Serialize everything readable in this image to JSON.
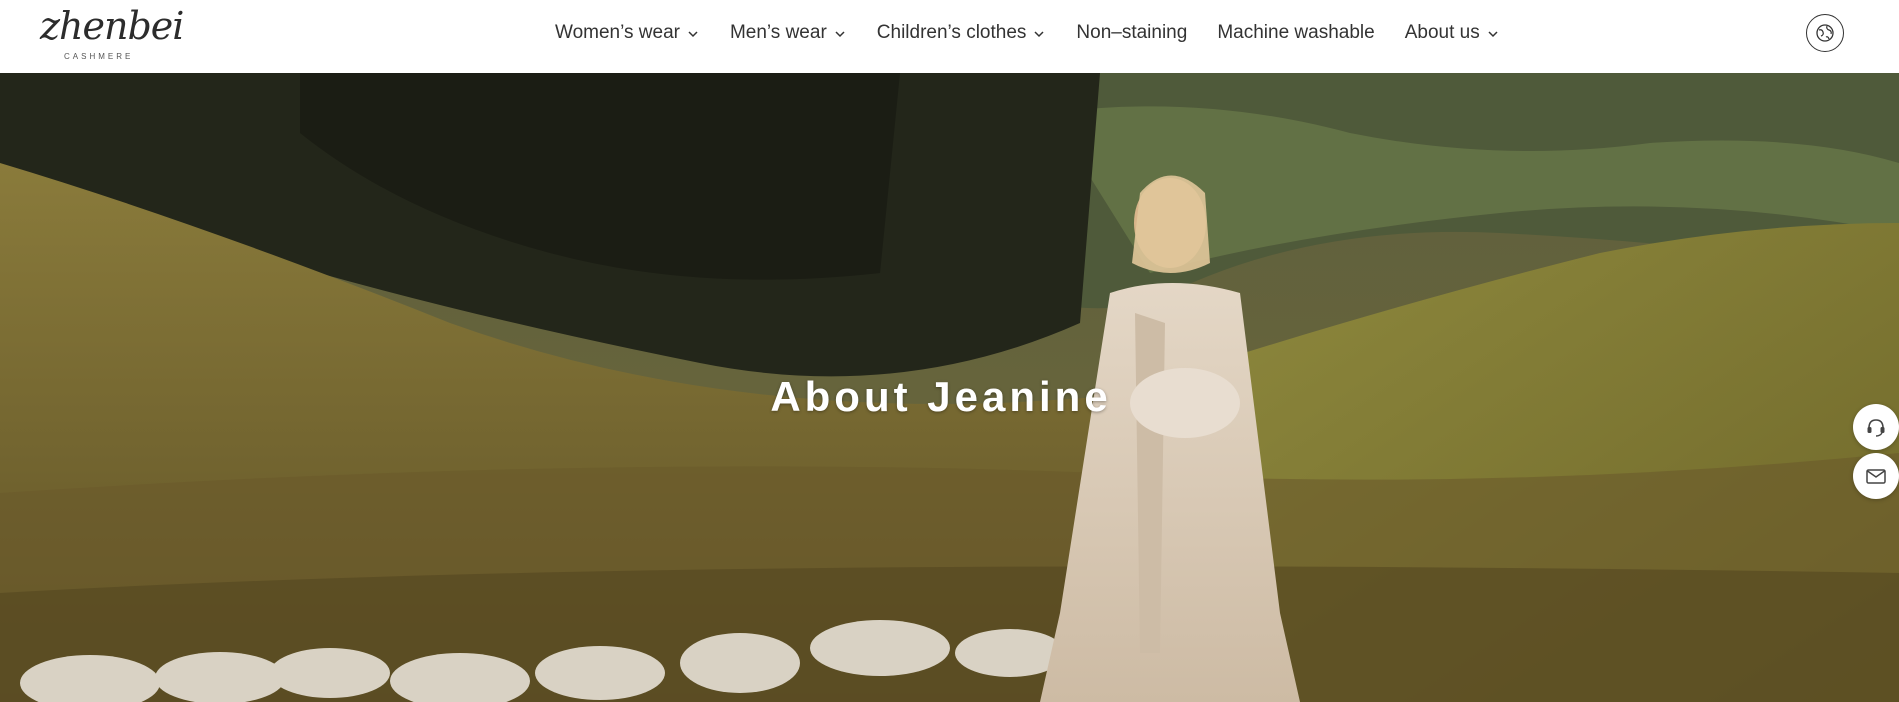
{
  "header": {
    "logo": {
      "word": "zhenbei",
      "sub": "CASHMERE"
    },
    "nav": [
      {
        "label": "Women’s wear",
        "dropdown": true
      },
      {
        "label": "Men’s wear",
        "dropdown": true
      },
      {
        "label": "Children’s clothes",
        "dropdown": true
      },
      {
        "label": "Non–staining",
        "dropdown": false
      },
      {
        "label": "Machine washable",
        "dropdown": false
      },
      {
        "label": "About us",
        "dropdown": true
      }
    ],
    "language_icon": "globe-icon"
  },
  "hero": {
    "title": "About Jeanine"
  },
  "side_actions": [
    {
      "icon": "customer-service-icon"
    },
    {
      "icon": "mail-icon"
    }
  ],
  "colors": {
    "nav_text": "#333333",
    "hero_title": "#ffffff",
    "header_bg": "#ffffff"
  }
}
